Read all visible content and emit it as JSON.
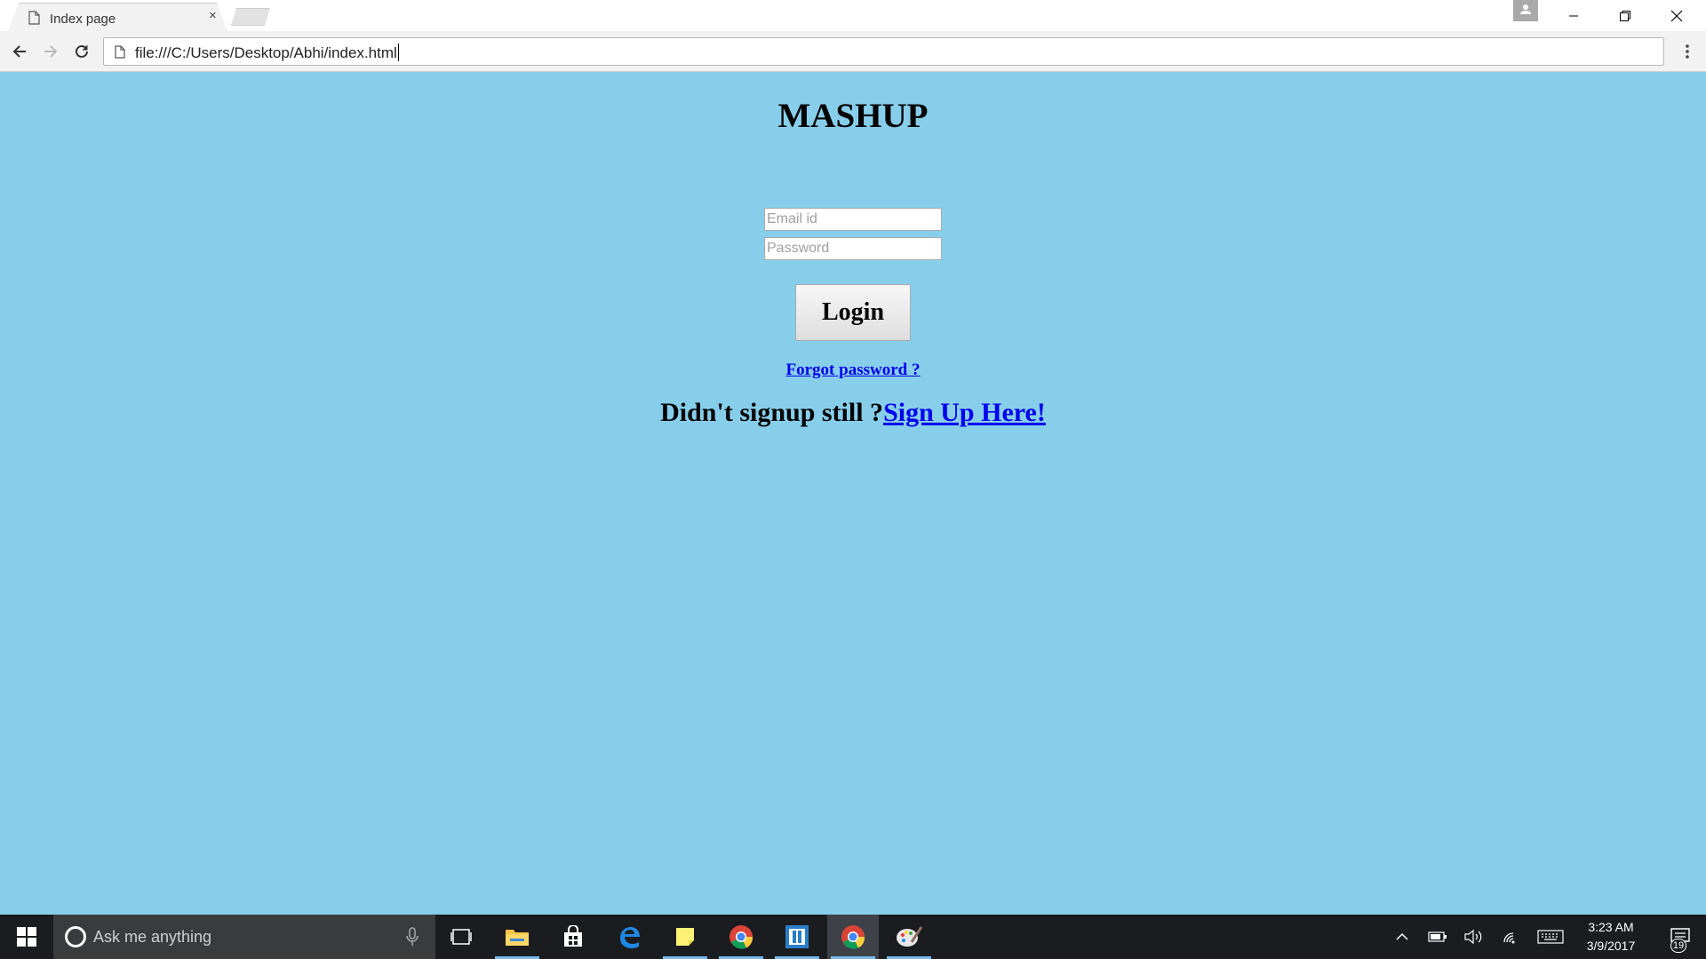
{
  "browser": {
    "tab_title": "Index page",
    "tab_close_glyph": "×",
    "url": "file:///C:/Users/Desktop/Abhi/index.html",
    "icons": [
      "page-icon",
      "close-icon",
      "new-tab-icon",
      "profile-icon",
      "minimize-icon",
      "restore-icon",
      "window-close-icon",
      "back-icon",
      "forward-icon",
      "reload-icon",
      "menu-icon"
    ]
  },
  "page": {
    "title": "MASHUP",
    "email_placeholder": "Email id",
    "password_placeholder": "Password",
    "login_label": "Login",
    "forgot_link": "Forgot password ?",
    "signup_prompt": "Didn't signup still ?",
    "signup_link": "Sign Up Here!",
    "background_color": "#87ceeb",
    "link_color": "#0000ee"
  },
  "taskbar": {
    "search_placeholder": "Ask me anything",
    "time": "3:23 AM",
    "date": "3/9/2017",
    "notification_count": "19",
    "apps": [
      "task-view-icon",
      "file-explorer-icon",
      "store-icon",
      "edge-icon",
      "sticky-notes-icon",
      "chrome-icon",
      "app-icon",
      "chrome-icon",
      "paint-icon"
    ],
    "tray": [
      "chevron-up-icon",
      "battery-icon",
      "volume-icon",
      "wifi-icon",
      "keyboard-icon"
    ]
  }
}
